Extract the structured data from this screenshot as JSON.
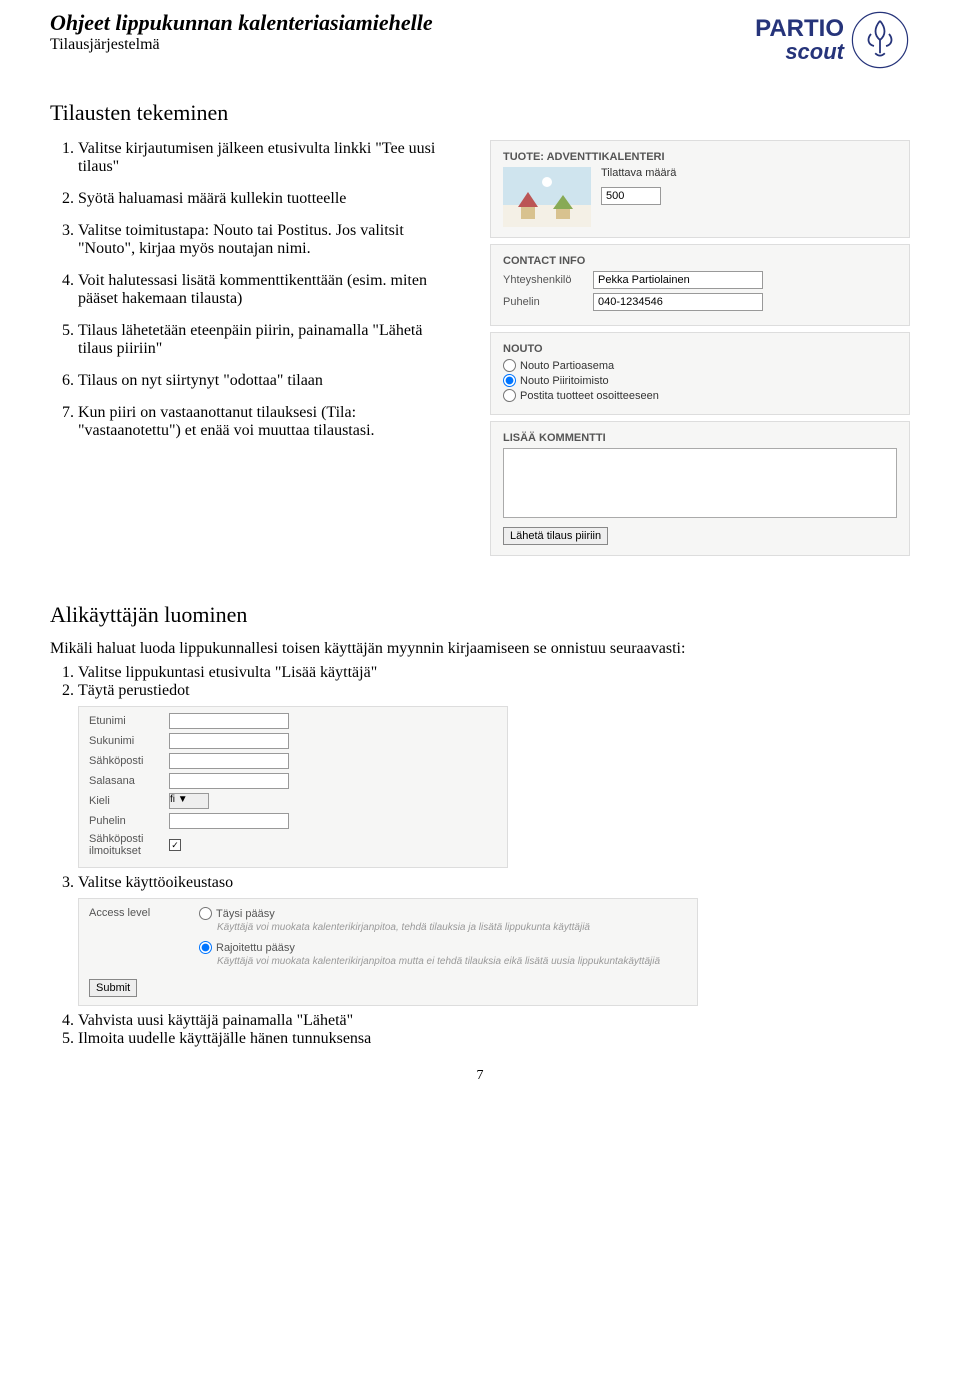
{
  "header": {
    "title": "Ohjeet lippukunnan kalenteriasiamiehelle",
    "subtitle": "Tilausjärjestelmä"
  },
  "logo": {
    "brand": "PARTIO",
    "sub": "scout"
  },
  "section1": {
    "title": "Tilausten tekeminen",
    "items": [
      "Valitse kirjautumisen jälkeen etusivulta linkki \"Tee uusi tilaus\"",
      "Syötä haluamasi määrä kullekin tuotteelle",
      "Valitse toimitustapa: Nouto tai Postitus. Jos valitsit \"Nouto\", kirjaa myös noutajan nimi.",
      "Voit halutessasi lisätä kommenttikenttään (esim. miten pääset hakemaan tilausta)",
      "Tilaus lähetetään eteenpäin piirin, painamalla \"Lähetä tilaus piiriin\"",
      "Tilaus on nyt siirtynyt \"odottaa\" tilaan",
      "Kun piiri on vastaanottanut tilauksesi (Tila: \"vastaanotettu\") et enää voi muuttaa tilaustasi."
    ]
  },
  "product": {
    "heading": "TUOTE: ADVENTTIKALENTERI",
    "qty_label": "Tilattava määrä",
    "qty_value": "500"
  },
  "contact": {
    "heading": "CONTACT INFO",
    "person_label": "Yhteyshenkilö",
    "person_value": "Pekka Partiolainen",
    "phone_label": "Puhelin",
    "phone_value": "040-1234546"
  },
  "pickup": {
    "heading": "NOUTO",
    "options": [
      "Nouto Partioasema",
      "Nouto Piiritoimisto",
      "Postita tuotteet osoitteeseen"
    ],
    "selected": 1
  },
  "comment": {
    "heading": "LISÄÄ KOMMENTTI",
    "button": "Lähetä tilaus piiriin"
  },
  "section2": {
    "title": "Alikäyttäjän luominen",
    "intro": "Mikäli haluat luoda lippukunnallesi toisen käyttäjän myynnin kirjaamiseen se onnistuu seuraavasti:",
    "step1": "Valitse lippukuntasi etusivulta \"Lisää käyttäjä\"",
    "step2": "Täytä perustiedot",
    "step3": "Valitse käyttöoikeustaso",
    "step4": "Vahvista uusi käyttäjä painamalla \"Lähetä\"",
    "step5": "Ilmoita uudelle käyttäjälle hänen tunnuksensa"
  },
  "userform": {
    "fields": [
      "Etunimi",
      "Sukunimi",
      "Sähköposti",
      "Salasana",
      "Kieli",
      "Puhelin",
      "Sähköposti ilmoitukset"
    ],
    "lang_value": "fi",
    "checkbox_checked": true
  },
  "access": {
    "label": "Access level",
    "opt1": "Täysi pääsy",
    "desc1": "Käyttäjä voi muokata kalenterikirjanpitoa, tehdä tilauksia ja lisätä lippukunta käyttäjiä",
    "opt2": "Rajoitettu pääsy",
    "desc2": "Käyttäjä voi muokata kalenterikirjanpitoa mutta ei tehdä tilauksia eikä lisätä uusia lippukuntakäyttäjiä",
    "selected": 1,
    "submit": "Submit"
  },
  "page_number": "7"
}
